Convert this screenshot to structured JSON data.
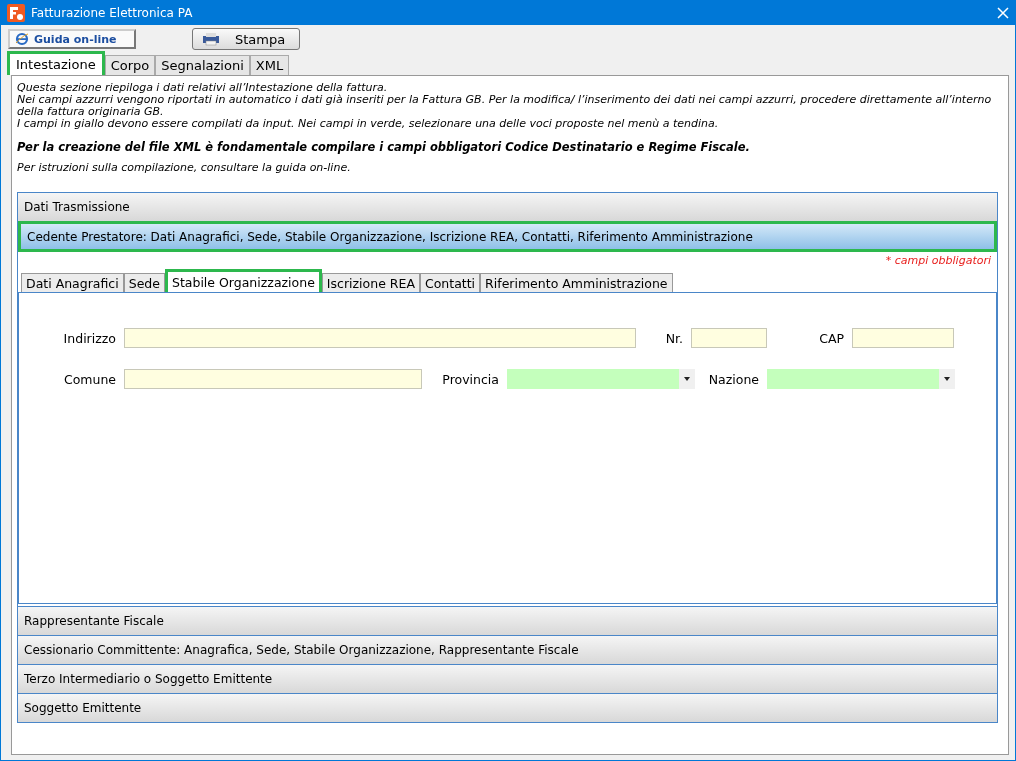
{
  "window": {
    "title": "Fatturazione Elettronica PA"
  },
  "toolbar": {
    "help_button": "Guida on-line",
    "print_button": "Stampa"
  },
  "tabs": [
    {
      "label": "Intestazione",
      "selected": true
    },
    {
      "label": "Corpo",
      "selected": false
    },
    {
      "label": "Segnalazioni",
      "selected": false
    },
    {
      "label": "XML",
      "selected": false
    }
  ],
  "intro": {
    "lines": [
      "Questa sezione riepiloga i dati relativi all’Intestazione della fattura.",
      "Nei campi azzurri vengono riportati in automatico i dati già inseriti per la Fattura GB. Per la modifica/ l’inserimento dei dati nei campi azzurri, procedere direttamente all’interno della fattura originaria GB.",
      "I campi in giallo devono essere compilati da input. Nei campi in verde, selezionare una delle voci proposte nel menù a tendina."
    ],
    "notice": "Per la creazione del file XML è fondamentale compilare i campi obbligatori Codice Destinatario e Regime Fiscale.",
    "hint": "Per istruzioni sulla compilazione, consultare la guida on-line."
  },
  "sections_before": [
    {
      "title": "Dati Trasmissione",
      "expanded": false
    },
    {
      "title": "Cedente Prestatore: Dati Anagrafici, Sede, Stabile Organizzazione, Iscrizione REA, Contatti, Riferimento Amministrazione",
      "expanded": true
    }
  ],
  "required_note": "* campi obbligatori",
  "sub_tabs": [
    {
      "label": "Dati Anagrafici",
      "selected": false
    },
    {
      "label": "Sede",
      "selected": false
    },
    {
      "label": "Stabile Organizzazione",
      "selected": true
    },
    {
      "label": "Iscrizione REA",
      "selected": false
    },
    {
      "label": "Contatti",
      "selected": false
    },
    {
      "label": "Riferimento Amministrazione",
      "selected": false
    }
  ],
  "form_rows": [
    [
      {
        "label": "Indirizzo",
        "kind": "text"
      },
      {
        "label": "Nr.",
        "kind": "text"
      },
      {
        "label": "CAP",
        "kind": "text"
      }
    ],
    [
      {
        "label": "Comune",
        "kind": "text"
      },
      {
        "label": "Provincia",
        "kind": "dropdown"
      },
      {
        "label": "Nazione",
        "kind": "dropdown"
      }
    ]
  ],
  "sections_after": [
    {
      "title": "Rappresentante Fiscale",
      "expanded": false
    },
    {
      "title": "Cessionario Committente: Anagrafica, Sede, Stabile Organizzazione, Rappresentante Fiscale",
      "expanded": false
    },
    {
      "title": "Terzo Intermediario o Soggetto Emittente",
      "expanded": false
    },
    {
      "title": "Soggetto Emittente",
      "expanded": false
    }
  ]
}
